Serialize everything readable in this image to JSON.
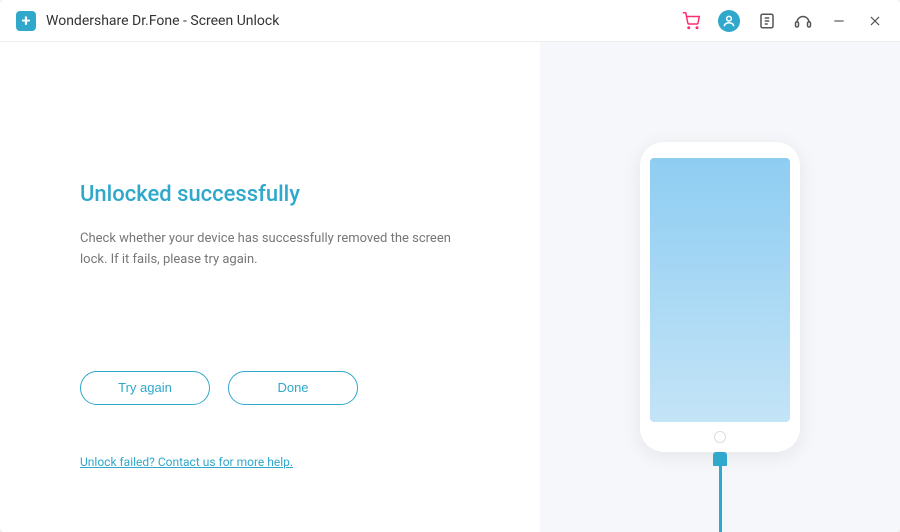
{
  "titlebar": {
    "app_name": "Wondershare Dr.Fone - Screen Unlock"
  },
  "main": {
    "heading": "Unlocked successfully",
    "description": "Check whether your device has successfully removed the screen lock. If it fails, please try again.",
    "try_again_label": "Try again",
    "done_label": "Done",
    "help_link": "Unlock failed? Contact us for more help."
  },
  "colors": {
    "accent": "#2fa8cc",
    "cart": "#ff2d6f"
  }
}
